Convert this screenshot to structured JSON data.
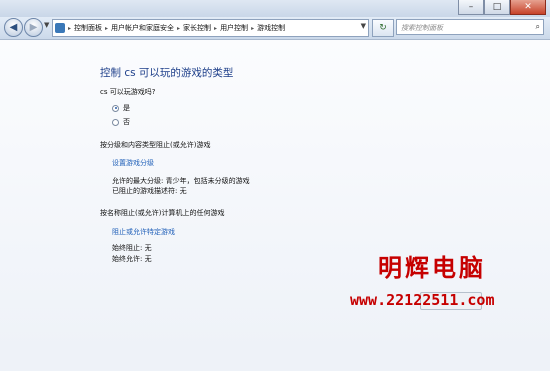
{
  "window": {
    "controls": {
      "minimize": "–",
      "maximize": "□",
      "close": "✕"
    }
  },
  "nav": {
    "back_icon": "◀",
    "forward_icon": "▶",
    "dropdown_icon": "▼",
    "refresh_icon": "↻",
    "breadcrumb": [
      "控制面板",
      "用户帐户和家庭安全",
      "家长控制",
      "用户控制",
      "游戏控制"
    ],
    "breadcrumb_separator": "▸",
    "search_placeholder": "搜索控制面板"
  },
  "page": {
    "title": "控制 cs 可以玩的游戏的类型",
    "question": "cs 可以玩游戏吗?",
    "options": [
      {
        "label": "是",
        "selected": true
      },
      {
        "label": "否",
        "selected": false
      }
    ],
    "section_rating": {
      "heading": "按分级和内容类型阻止(或允许)游戏",
      "link": "设置游戏分级",
      "details": [
        "允许的最大分级: 青少年，包括未分级的游戏",
        "已阻止的游戏描述符: 无"
      ]
    },
    "section_specific": {
      "heading": "按名称阻止(或允许)计算机上的任何游戏",
      "link": "阻止或允许特定游戏",
      "details": [
        "始终阻止: 无",
        "始终允许: 无"
      ]
    }
  },
  "watermark": {
    "title": "明辉电脑",
    "url": "www.22122511.com"
  }
}
